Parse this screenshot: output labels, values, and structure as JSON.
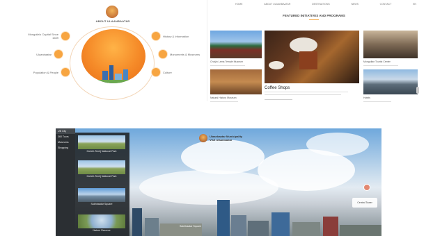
{
  "screenshot_1": {
    "title": "ABOUT ULAANBAATAR",
    "left_items": [
      "Mongolia's Capital Since 1639",
      "Ulaanbaatar",
      "Population & People"
    ],
    "right_items": [
      "History & Information",
      "Monuments & Museums",
      "Culture"
    ]
  },
  "screenshot_2": {
    "nav": [
      "HOME",
      "ABOUT ULAANBAATAR",
      "DESTINATIONS",
      "NEWS",
      "CONTACT",
      "EN"
    ],
    "heading": "FEATURED INITIATIVES AND PROGRAMS",
    "cards": [
      {
        "caption": "Choijin Lama Temple Museum"
      },
      {
        "caption": "Coffee Shops"
      },
      {
        "caption": "Mongolian Tourist Center"
      },
      {
        "caption": "Natural History Museum"
      },
      {
        "caption": "Hotels"
      }
    ]
  },
  "screenshot_3": {
    "tabs": [
      "UB City",
      "360 Tours",
      "Museums",
      "Shopping"
    ],
    "thumbnails": [
      "Gorkhi-Terelj National Park",
      "Gorkhi-Terelj National Park",
      "Sukhbaatar Square",
      "Nature Reserve"
    ],
    "logo_text": [
      "Ulaanbaatar Municipality",
      "Visit Ulaanbaatar"
    ],
    "info_label": "Central Tower",
    "ground_label": "Sukhbaatar Square"
  }
}
